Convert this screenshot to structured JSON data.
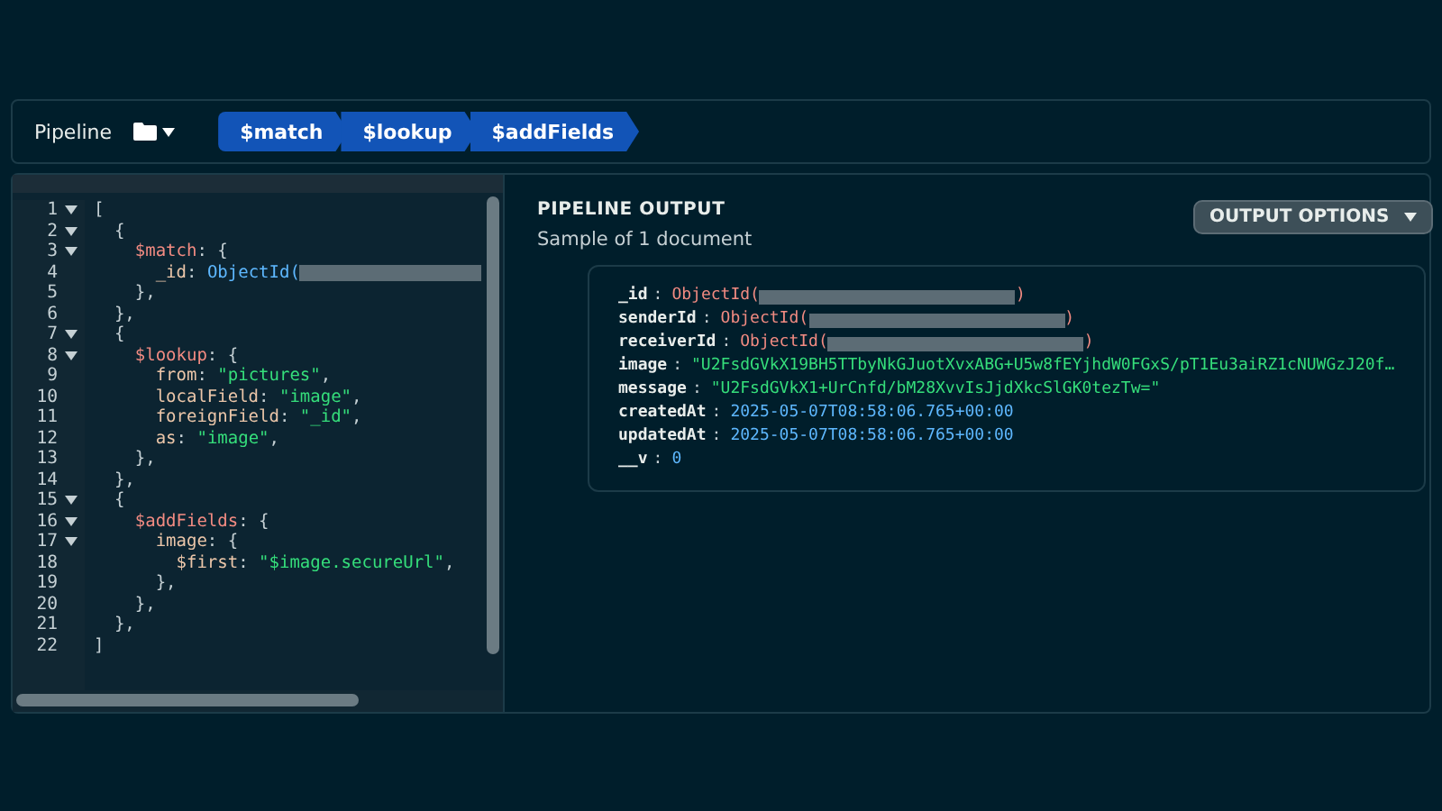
{
  "toolbar": {
    "label": "Pipeline",
    "stages": [
      {
        "label": "$match"
      },
      {
        "label": "$lookup"
      },
      {
        "label": "$addFields"
      }
    ]
  },
  "editor": {
    "lines": [
      {
        "number": "1",
        "fold": true,
        "tokens": [
          {
            "kind": "punct",
            "text": "["
          }
        ]
      },
      {
        "number": "2",
        "fold": true,
        "tokens": [
          {
            "kind": "punct",
            "text": "  {"
          }
        ]
      },
      {
        "number": "3",
        "fold": true,
        "tokens": [
          {
            "kind": "stage",
            "text": "    $match"
          },
          {
            "kind": "punct",
            "text": ": {"
          }
        ]
      },
      {
        "number": "4",
        "fold": false,
        "tokens": [
          {
            "kind": "key",
            "text": "      _id"
          },
          {
            "kind": "punct",
            "text": ": "
          },
          {
            "kind": "func",
            "text": "ObjectId("
          },
          {
            "kind": "redacted"
          }
        ]
      },
      {
        "number": "5",
        "fold": false,
        "tokens": [
          {
            "kind": "punct",
            "text": "    },"
          }
        ]
      },
      {
        "number": "6",
        "fold": false,
        "tokens": [
          {
            "kind": "punct",
            "text": "  },"
          }
        ]
      },
      {
        "number": "7",
        "fold": true,
        "tokens": [
          {
            "kind": "punct",
            "text": "  {"
          }
        ]
      },
      {
        "number": "8",
        "fold": true,
        "tokens": [
          {
            "kind": "stage",
            "text": "    $lookup"
          },
          {
            "kind": "punct",
            "text": ": {"
          }
        ]
      },
      {
        "number": "9",
        "fold": false,
        "tokens": [
          {
            "kind": "key",
            "text": "      from"
          },
          {
            "kind": "punct",
            "text": ": "
          },
          {
            "kind": "string",
            "text": "\"pictures\""
          },
          {
            "kind": "punct",
            "text": ","
          }
        ]
      },
      {
        "number": "10",
        "fold": false,
        "tokens": [
          {
            "kind": "key",
            "text": "      localField"
          },
          {
            "kind": "punct",
            "text": ": "
          },
          {
            "kind": "string",
            "text": "\"image\""
          },
          {
            "kind": "punct",
            "text": ","
          }
        ]
      },
      {
        "number": "11",
        "fold": false,
        "tokens": [
          {
            "kind": "key",
            "text": "      foreignField"
          },
          {
            "kind": "punct",
            "text": ": "
          },
          {
            "kind": "string",
            "text": "\"_id\""
          },
          {
            "kind": "punct",
            "text": ","
          }
        ]
      },
      {
        "number": "12",
        "fold": false,
        "tokens": [
          {
            "kind": "key",
            "text": "      as"
          },
          {
            "kind": "punct",
            "text": ": "
          },
          {
            "kind": "string",
            "text": "\"image\""
          },
          {
            "kind": "punct",
            "text": ","
          }
        ]
      },
      {
        "number": "13",
        "fold": false,
        "tokens": [
          {
            "kind": "punct",
            "text": "    },"
          }
        ]
      },
      {
        "number": "14",
        "fold": false,
        "tokens": [
          {
            "kind": "punct",
            "text": "  },"
          }
        ]
      },
      {
        "number": "15",
        "fold": true,
        "tokens": [
          {
            "kind": "punct",
            "text": "  {"
          }
        ]
      },
      {
        "number": "16",
        "fold": true,
        "tokens": [
          {
            "kind": "stage",
            "text": "    $addFields"
          },
          {
            "kind": "punct",
            "text": ": {"
          }
        ]
      },
      {
        "number": "17",
        "fold": true,
        "tokens": [
          {
            "kind": "key",
            "text": "      image"
          },
          {
            "kind": "punct",
            "text": ": {"
          }
        ]
      },
      {
        "number": "18",
        "fold": false,
        "tokens": [
          {
            "kind": "key",
            "text": "        $first"
          },
          {
            "kind": "punct",
            "text": ": "
          },
          {
            "kind": "string",
            "text": "\"$image.secureUrl\""
          },
          {
            "kind": "punct",
            "text": ","
          }
        ]
      },
      {
        "number": "19",
        "fold": false,
        "tokens": [
          {
            "kind": "punct",
            "text": "      },"
          }
        ]
      },
      {
        "number": "20",
        "fold": false,
        "tokens": [
          {
            "kind": "punct",
            "text": "    },"
          }
        ]
      },
      {
        "number": "21",
        "fold": false,
        "tokens": [
          {
            "kind": "punct",
            "text": "  },"
          }
        ]
      },
      {
        "number": "22",
        "fold": false,
        "tokens": [
          {
            "kind": "punct",
            "text": "]"
          }
        ]
      }
    ]
  },
  "output": {
    "title": "PIPELINE OUTPUT",
    "subtitle": "Sample of 1 document",
    "options_button": "OUTPUT OPTIONS",
    "fields": [
      {
        "key": "_id",
        "separator": ":",
        "kind": "objectid",
        "value": "ObjectId(",
        "close": ")"
      },
      {
        "key": "senderId",
        "separator": ":",
        "kind": "objectid",
        "value": "ObjectId(",
        "close": ")"
      },
      {
        "key": "receiverId",
        "separator": ":",
        "kind": "objectid",
        "value": "ObjectId(",
        "close": ")"
      },
      {
        "key": "image",
        "separator": ":",
        "kind": "string",
        "value": "\"U2FsdGVkX19BH5TTbyNkGJuotXvxABG+U5w8fEYjhdW0FGxS/pT1Eu3aiRZ1cNUWGzJ20f…"
      },
      {
        "key": "message",
        "separator": ":",
        "kind": "string",
        "value": "\"U2FsdGVkX1+UrCnfd/bM28XvvIsJjdXkcSlGK0tezTw=\""
      },
      {
        "key": "createdAt",
        "separator": ":",
        "kind": "date",
        "value": "2025-05-07T08:58:06.765+00:00"
      },
      {
        "key": "updatedAt",
        "separator": ":",
        "kind": "date",
        "value": "2025-05-07T08:58:06.765+00:00"
      },
      {
        "key": "__v",
        "separator": ":",
        "kind": "number",
        "value": "0"
      }
    ]
  }
}
